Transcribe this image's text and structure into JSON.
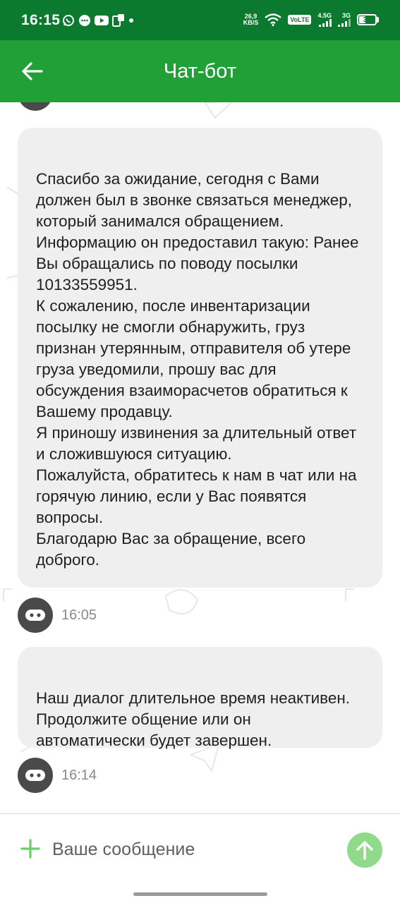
{
  "status_bar": {
    "time": "16:15",
    "network_speed_value": "26,9",
    "network_speed_unit": "KB/S",
    "volte": "VoLTE",
    "sim1_label": "4.5G",
    "sim2_label": "3G",
    "battery": "39",
    "battery_level": 0.39,
    "icons_left": [
      "whatsapp-icon",
      "message-icon",
      "youtube-icon",
      "phone-notification-icon",
      "dot-icon"
    ],
    "icons_right": [
      "wifi-icon",
      "signal-icon",
      "signal-icon",
      "battery-icon"
    ]
  },
  "app_bar": {
    "title": "Чат-бот",
    "back_icon": "arrow-left-icon",
    "color": "#21a038"
  },
  "messages": [
    {
      "text": "Спасибо за ожидание, сегодня с Вами должен был в звонке связаться менеджер, который занимался обращением. Информацию он предоставил такую: Ранее Вы обращались по поводу посылки 10133559951.\nК сожалению, после инвентаризации посылку не смогли обнаружить, груз признан утерянным, отправителя об утере груза уведомили, прошу вас для обсуждения взаиморасчетов обратиться к Вашему продавцу.\nЯ приношу извинения за длительный ответ и сложившуюся ситуацию.\nПожалуйста, обратитесь к нам в чат или на горячую линию, если у Вас появятся вопросы.\nБлагодарю Вас за обращение, всего доброго.",
      "time": "16:05"
    },
    {
      "text": "Наш диалог длительное время неактивен. Продолжите общение или он автоматически будет завершен.",
      "time": "16:14"
    }
  ],
  "input": {
    "placeholder": "Ваше сообщение",
    "value": "",
    "attach_icon": "plus-icon",
    "send_icon": "arrow-up-icon",
    "send_color": "#8fdb8b"
  },
  "colors": {
    "status_bar": "#0b7a2e",
    "accent": "#21a038",
    "bubble": "#efefef",
    "avatar": "#4a4a4a"
  }
}
